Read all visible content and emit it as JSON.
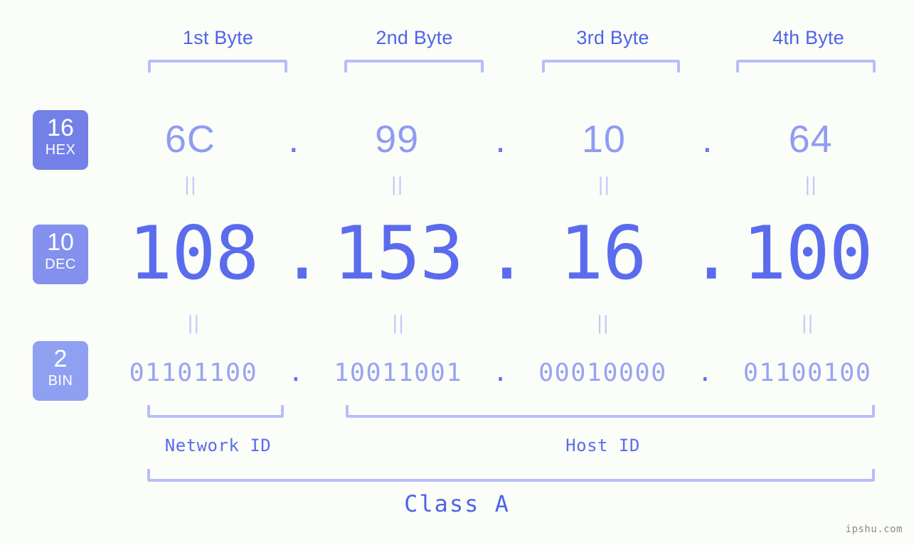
{
  "page": {
    "background_color": "#fbfdf8",
    "accent_color": "#5a6ced",
    "bracket_color": "#b6bffb",
    "watermark": "ipshu.com"
  },
  "byte_headers": [
    {
      "label": "1st Byte"
    },
    {
      "label": "2nd Byte"
    },
    {
      "label": "3rd Byte"
    },
    {
      "label": "4th Byte"
    }
  ],
  "bases": [
    {
      "number": "16",
      "name": "HEX",
      "color": "#7380e8"
    },
    {
      "number": "10",
      "name": "DEC",
      "color": "#8390ee"
    },
    {
      "number": "2",
      "name": "BIN",
      "color": "#8fa0f2"
    }
  ],
  "rows": {
    "hex": {
      "base_number": "16",
      "base_name": "HEX",
      "values": [
        "6C",
        "99",
        "10",
        "64"
      ],
      "separator": "."
    },
    "dec": {
      "base_number": "10",
      "base_name": "DEC",
      "values": [
        "108",
        "153",
        "16",
        "100"
      ],
      "separator": "."
    },
    "bin": {
      "base_number": "2",
      "base_name": "BIN",
      "values": [
        "01101100",
        "10011001",
        "00010000",
        "01100100"
      ],
      "separator": "."
    }
  },
  "equals": {
    "glyph": "||"
  },
  "regions": [
    {
      "label": "Network ID"
    },
    {
      "label": "Host ID"
    }
  ],
  "class": {
    "label": "Class A"
  }
}
